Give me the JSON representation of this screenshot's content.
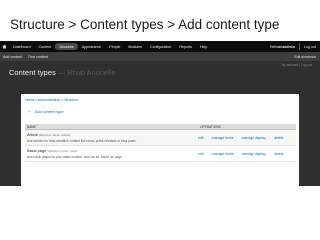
{
  "slide": {
    "title": "Structure > Content types > Add content type"
  },
  "toolbar": {
    "items": [
      "Dashboard",
      "Content",
      "Structure",
      "Appearance",
      "People",
      "Modules",
      "Configuration",
      "Reports",
      "Help"
    ],
    "active_index": 2,
    "user_greeting": "Hello ",
    "username": "onsadmin",
    "logout": "Log out"
  },
  "shortcuts": {
    "items": [
      "Add content",
      "Find content"
    ],
    "edit": "Edit shortcuts"
  },
  "userbar": {
    "text": "My account  |  Log out"
  },
  "page": {
    "title": "Content types",
    "ghost": "— Rhub Anonelle"
  },
  "breadcrumb": "Home » Administration » Structure",
  "add_link": "Add content type",
  "table": {
    "headers": {
      "name": "NAME",
      "operations": "OPERATIONS"
    },
    "rows": [
      {
        "title": "Article",
        "machine": "(Machine name: article)",
        "description": "Use articles for time-sensitive content like news, press releases or blog posts.",
        "ops": [
          "edit",
          "manage fields",
          "manage display",
          "delete"
        ]
      },
      {
        "title": "Basic page",
        "machine": "(Machine name: page)",
        "description": "Use basic pages for your static content, such as an 'About us' page.",
        "ops": [
          "edit",
          "manage fields",
          "manage display",
          "delete"
        ]
      }
    ]
  },
  "colors": {
    "link": "#0074bd",
    "toolbar": "#0c0c0c",
    "overlay": "#2f2f2f"
  },
  "icons": {
    "home": "home-icon",
    "add": "plus-icon"
  }
}
